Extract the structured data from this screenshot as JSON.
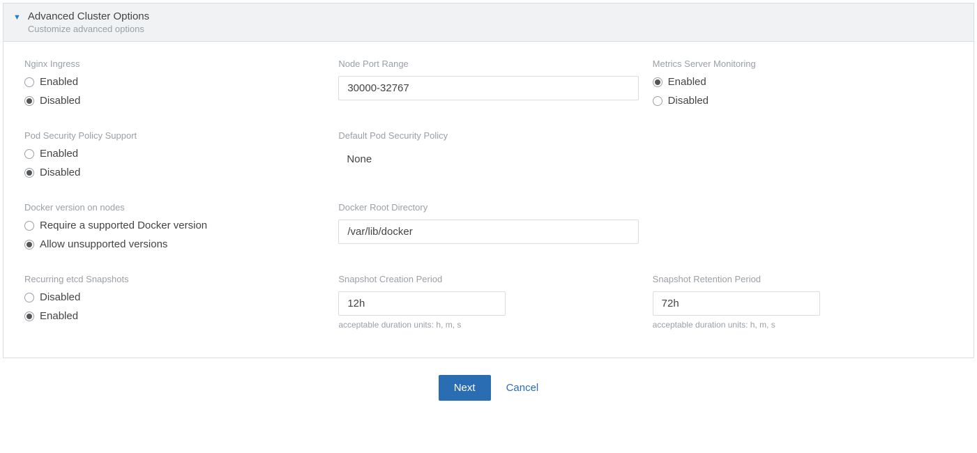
{
  "header": {
    "title": "Advanced Cluster Options",
    "subtitle": "Customize advanced options"
  },
  "fields": {
    "nginx_ingress": {
      "label": "Nginx Ingress",
      "options": {
        "enabled": "Enabled",
        "disabled": "Disabled"
      },
      "selected": "disabled"
    },
    "node_port_range": {
      "label": "Node Port Range",
      "value": "30000-32767"
    },
    "metrics_server": {
      "label": "Metrics Server Monitoring",
      "options": {
        "enabled": "Enabled",
        "disabled": "Disabled"
      },
      "selected": "enabled"
    },
    "pod_security_support": {
      "label": "Pod Security Policy Support",
      "options": {
        "enabled": "Enabled",
        "disabled": "Disabled"
      },
      "selected": "disabled"
    },
    "default_pod_security_policy": {
      "label": "Default Pod Security Policy",
      "value": "None"
    },
    "docker_version": {
      "label": "Docker version on nodes",
      "options": {
        "require": "Require a supported Docker version",
        "allow": "Allow unsupported versions"
      },
      "selected": "allow"
    },
    "docker_root_dir": {
      "label": "Docker Root Directory",
      "value": "/var/lib/docker"
    },
    "etcd_snapshots": {
      "label": "Recurring etcd Snapshots",
      "options": {
        "disabled": "Disabled",
        "enabled": "Enabled"
      },
      "selected": "enabled"
    },
    "snapshot_creation": {
      "label": "Snapshot Creation Period",
      "value": "12h",
      "helper": "acceptable duration units: h, m, s"
    },
    "snapshot_retention": {
      "label": "Snapshot Retention Period",
      "value": "72h",
      "helper": "acceptable duration units: h, m, s"
    }
  },
  "footer": {
    "next": "Next",
    "cancel": "Cancel"
  }
}
